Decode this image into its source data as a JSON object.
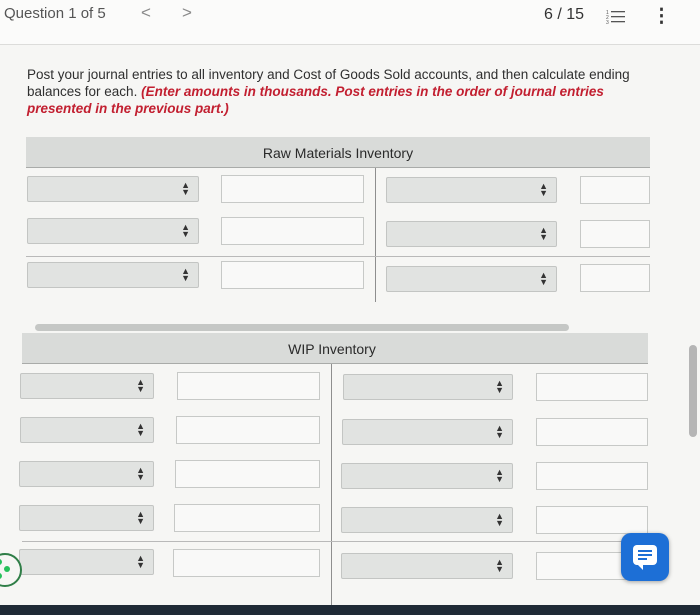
{
  "topbar": {
    "question_label": "Question 1 of 5",
    "prev_glyph": "<",
    "next_glyph": ">",
    "page_counter": "6 / 15",
    "more_glyph": "⋮"
  },
  "instructions": {
    "text": "Post your journal entries to all inventory and Cost of Goods Sold accounts, and then calculate ending balances for each. ",
    "emphasis": "(Enter amounts in thousands. Post entries in the order of journal entries presented in the previous part.)"
  },
  "raw_materials": {
    "title": "Raw Materials Inventory",
    "rows": [
      {
        "debit_account": "",
        "debit_amount": "",
        "credit_account": "",
        "credit_amount": ""
      },
      {
        "debit_account": "",
        "debit_amount": "",
        "credit_account": "",
        "credit_amount": ""
      },
      {
        "debit_account": "",
        "debit_amount": "",
        "credit_account": "",
        "credit_amount": ""
      }
    ]
  },
  "wip": {
    "title": "WIP Inventory",
    "rows": [
      {
        "debit_account": "",
        "debit_amount": "",
        "credit_account": "",
        "credit_amount": ""
      },
      {
        "debit_account": "",
        "debit_amount": "",
        "credit_account": "",
        "credit_amount": ""
      },
      {
        "debit_account": "",
        "debit_amount": "",
        "credit_account": "",
        "credit_amount": ""
      },
      {
        "debit_account": "",
        "debit_amount": "",
        "credit_account": "",
        "credit_amount": ""
      },
      {
        "debit_account": "",
        "debit_amount": "",
        "credit_account": "",
        "credit_amount": ""
      }
    ]
  },
  "colors": {
    "accent_red": "#c21f30",
    "chat_button": "#1d6fd6",
    "header_gray": "#d9dbd9"
  },
  "icons": {
    "list": "list-icon",
    "more": "more-vertical-icon",
    "chat": "chat-icon",
    "select_arrows": "updown-arrows-icon"
  }
}
